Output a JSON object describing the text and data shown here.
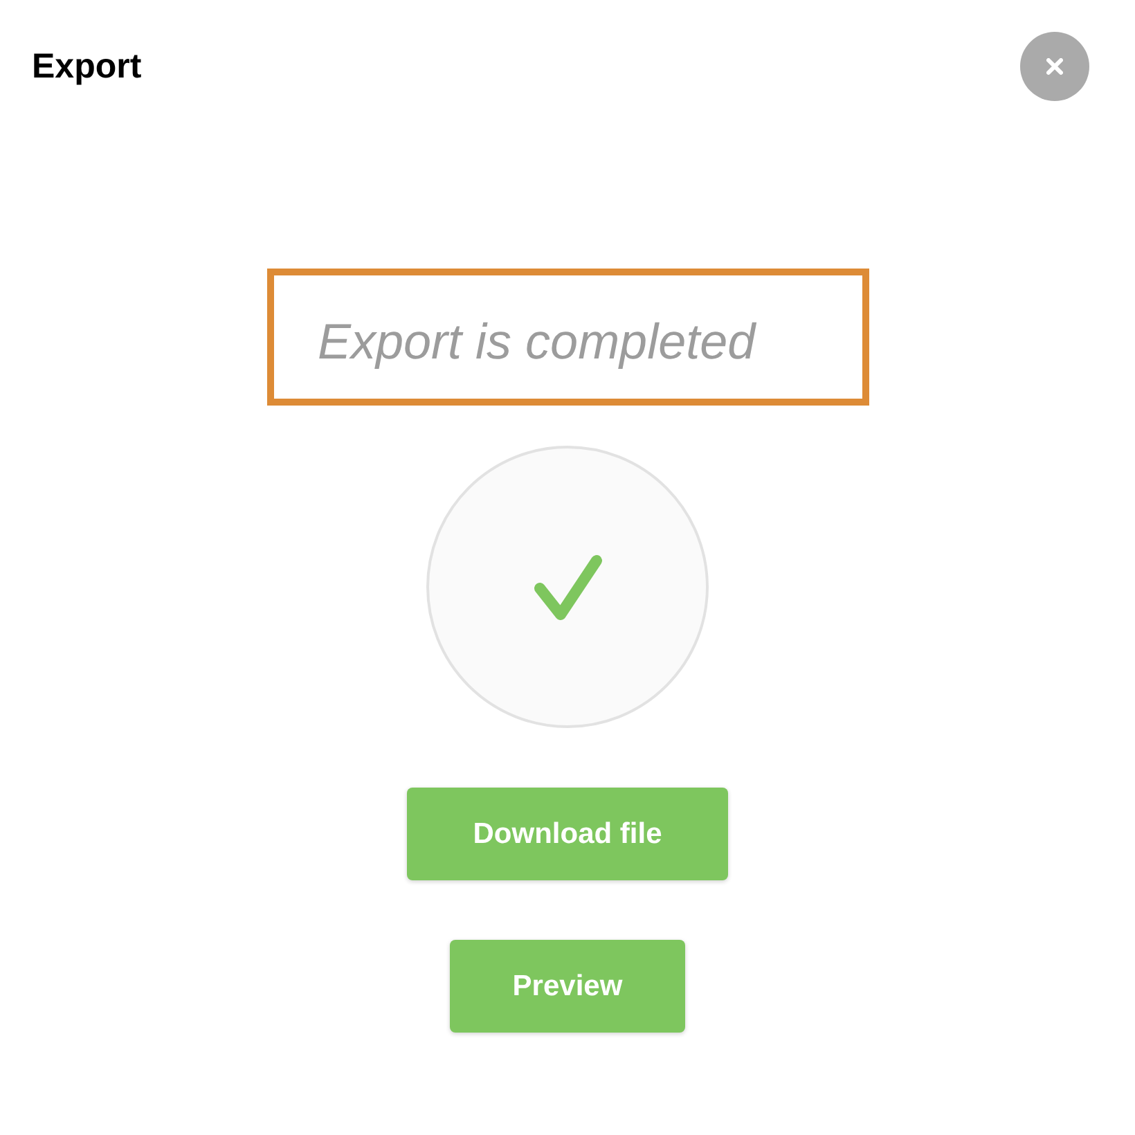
{
  "dialog": {
    "title": "Export"
  },
  "status": {
    "message": "Export is completed",
    "highlighted": true,
    "done": true
  },
  "buttons": [
    {
      "label": "Download file"
    },
    {
      "label": "Preview"
    }
  ]
}
